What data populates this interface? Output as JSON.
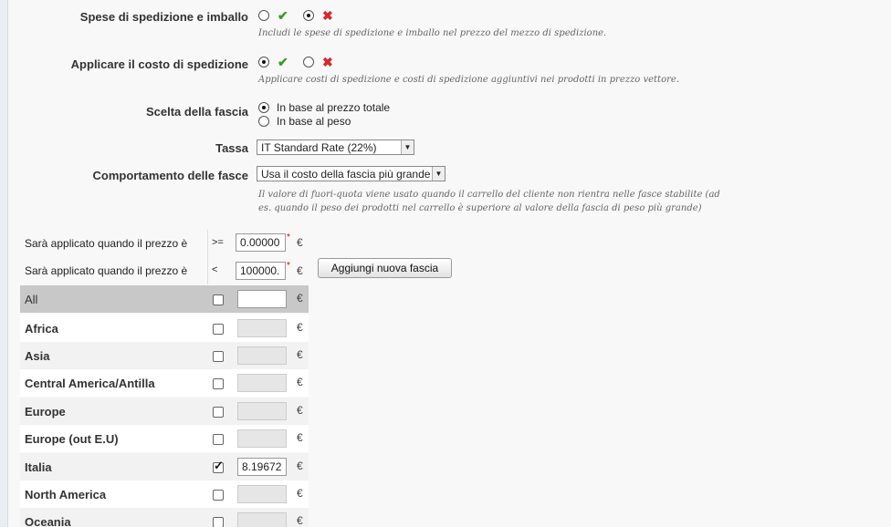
{
  "fields": {
    "shipping_handling": {
      "label": "Spese di spedizione e imballo",
      "options": [
        {
          "icon": "check-icon",
          "glyph": "✔",
          "selected": false
        },
        {
          "icon": "cross-icon",
          "glyph": "✖",
          "selected": true
        }
      ],
      "hint": "Includi le spese di spedizione e imballo nel prezzo del mezzo di spedizione."
    },
    "apply_shipping_cost": {
      "label": "Applicare il costo di spedizione",
      "options": [
        {
          "icon": "check-icon",
          "glyph": "✔",
          "selected": true
        },
        {
          "icon": "cross-icon",
          "glyph": "✖",
          "selected": false
        }
      ],
      "hint": "Applicare costi di spedizione e costi di spedizione aggiuntivi nei prodotti in prezzo vettore."
    },
    "range_choice": {
      "label": "Scelta della fascia",
      "options": [
        {
          "label": "In base al prezzo totale",
          "selected": true
        },
        {
          "label": "In base al peso",
          "selected": false
        }
      ]
    },
    "tax": {
      "label": "Tassa",
      "value": "IT Standard Rate (22%)"
    },
    "range_behavior": {
      "label": "Comportamento delle fasce",
      "value": "Usa il costo della fascia più grande",
      "hint_line1": "Il valore di fuori-quota viene usato quando il carrello del cliente non rientra nelle fasce stabilite (ad",
      "hint_line2": "es. quando il peso dei prodotti nel carrello è superiore al valore della fascia di peso più grande)"
    }
  },
  "ranges": {
    "rows": [
      {
        "label": "Sarà applicato quando il prezzo è",
        "operator": ">=",
        "value": "0.00000"
      },
      {
        "label": "Sarà applicato quando il prezzo è",
        "operator": "<",
        "value": "100000."
      }
    ],
    "required_mark": "*",
    "currency": "€",
    "add_button": "Aggiungi nuova fascia"
  },
  "zones": [
    {
      "name": "All",
      "checked": false,
      "value": ""
    },
    {
      "name": "Africa",
      "checked": false,
      "value": ""
    },
    {
      "name": "Asia",
      "checked": false,
      "value": ""
    },
    {
      "name": "Central America/Antilla",
      "checked": false,
      "value": ""
    },
    {
      "name": "Europe",
      "checked": false,
      "value": ""
    },
    {
      "name": "Europe (out E.U)",
      "checked": false,
      "value": ""
    },
    {
      "name": "Italia",
      "checked": true,
      "value": "8.19672"
    },
    {
      "name": "North America",
      "checked": false,
      "value": ""
    },
    {
      "name": "Oceania",
      "checked": false,
      "value": ""
    }
  ]
}
